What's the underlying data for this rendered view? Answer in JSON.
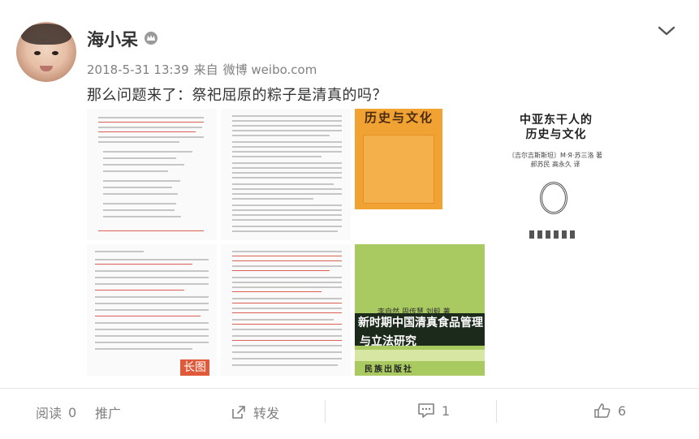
{
  "post": {
    "username": "海小呆",
    "timestamp": "2018-5-31 13:39",
    "source_prefix": "来自",
    "source": "微博 weibo.com",
    "text": "那么问题来了：祭祀屈原的粽子是清真的吗？"
  },
  "images": {
    "long_image_badge": "长图",
    "book_orange_title": "历史与文化",
    "book_white_title_line1": "中亚东干人的",
    "book_white_title_line2": "历史与文化",
    "book_white_sub": "〔吉尔吉斯斯坦〕M·Я·苏三洛 著",
    "book_white_sub2": "郝苏民 高永久 译",
    "book_green_authors": "李自然 周传慧 刘毅 著",
    "book_green_title_line1": "新时期中国清真食品管理",
    "book_green_title_line2": "与立法研究",
    "book_green_publisher": "民族出版社"
  },
  "footer": {
    "read_label": "阅读",
    "read_count": "0",
    "promote_label": "推广",
    "share_label": "转发",
    "comment_count": "1",
    "like_count": "6"
  },
  "icons": {
    "vip": "crown-badge-icon",
    "more": "chevron-down-icon",
    "share": "share-icon",
    "comment": "comment-icon",
    "like": "thumbs-up-icon"
  },
  "colors": {
    "accent_orange": "#f0a233",
    "badge_red": "#e05a3a",
    "green_cover": "#a9c961",
    "muted_text": "#808080"
  }
}
